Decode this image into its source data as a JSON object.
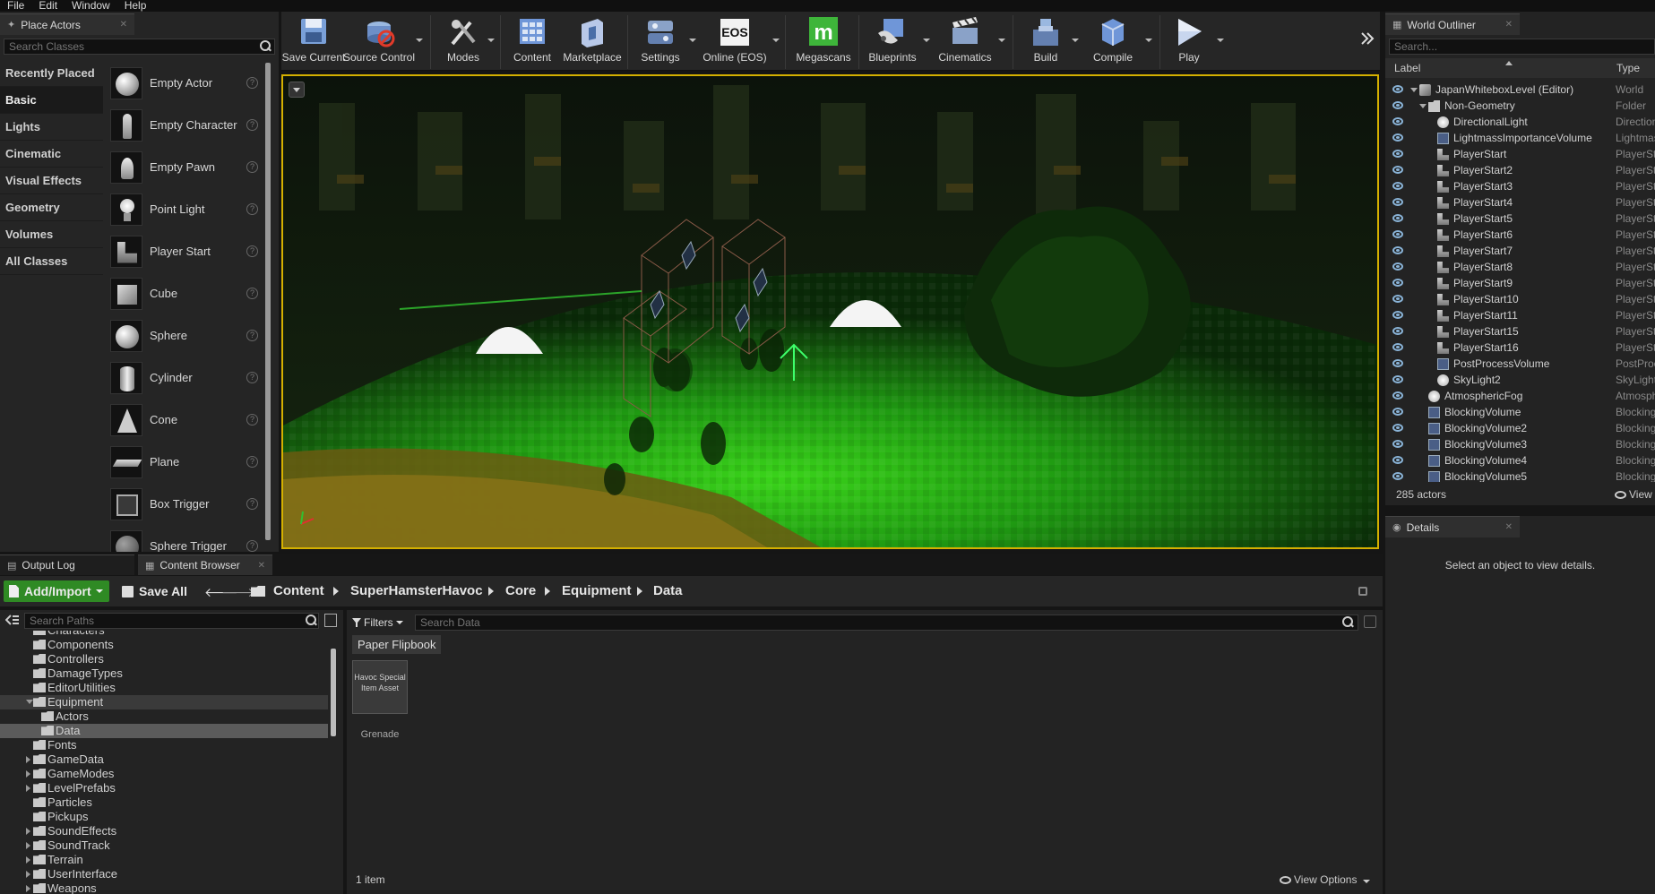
{
  "menu": [
    "File",
    "Edit",
    "Window",
    "Help"
  ],
  "place_actors": {
    "tab_title": "Place Actors",
    "search_placeholder": "Search Classes",
    "categories": [
      "Recently Placed",
      "Basic",
      "Lights",
      "Cinematic",
      "Visual Effects",
      "Geometry",
      "Volumes",
      "All Classes"
    ],
    "active_category": "Basic",
    "items": [
      "Empty Actor",
      "Empty Character",
      "Empty Pawn",
      "Point Light",
      "Player Start",
      "Cube",
      "Sphere",
      "Cylinder",
      "Cone",
      "Plane",
      "Box Trigger",
      "Sphere Trigger"
    ]
  },
  "toolbar": {
    "buttons": [
      {
        "label": "Save Current",
        "icon": "save-icon"
      },
      {
        "label": "Source Control",
        "icon": "source-control-icon"
      },
      {
        "label": "Modes",
        "icon": "modes-icon"
      },
      {
        "label": "Content",
        "icon": "content-icon"
      },
      {
        "label": "Marketplace",
        "icon": "marketplace-icon"
      },
      {
        "label": "Settings",
        "icon": "settings-icon"
      },
      {
        "label": "Online (EOS)",
        "icon": "eos-icon",
        "icon_text": "EOS"
      },
      {
        "label": "Megascans",
        "icon": "megascans-icon",
        "icon_text": "m"
      },
      {
        "label": "Blueprints",
        "icon": "blueprints-icon"
      },
      {
        "label": "Cinematics",
        "icon": "cinematics-icon"
      },
      {
        "label": "Build",
        "icon": "build-icon"
      },
      {
        "label": "Compile",
        "icon": "compile-icon"
      },
      {
        "label": "Play",
        "icon": "play-icon"
      }
    ],
    "accent_green": "#3eb53a",
    "accent_blue": "#6f96d8"
  },
  "world_outliner": {
    "tab_title": "World Outliner",
    "search_placeholder": "Search...",
    "col_label": "Label",
    "col_type": "Type",
    "rows": [
      {
        "label": "JapanWhiteboxLevel (Editor)",
        "type": "World",
        "icon": "world",
        "indent": 0,
        "tw": "open"
      },
      {
        "label": "Non-Geometry",
        "type": "Folder",
        "icon": "folder",
        "indent": 1,
        "tw": "open"
      },
      {
        "label": "DirectionalLight",
        "type": "DirectionalLight",
        "icon": "light",
        "indent": 2
      },
      {
        "label": "LightmassImportanceVolume",
        "type": "LightmassImportanceVolume",
        "icon": "volume",
        "indent": 2
      },
      {
        "label": "PlayerStart",
        "type": "PlayerStart",
        "icon": "player",
        "indent": 2
      },
      {
        "label": "PlayerStart2",
        "type": "PlayerStart",
        "icon": "player",
        "indent": 2
      },
      {
        "label": "PlayerStart3",
        "type": "PlayerStart",
        "icon": "player",
        "indent": 2
      },
      {
        "label": "PlayerStart4",
        "type": "PlayerStart",
        "icon": "player",
        "indent": 2
      },
      {
        "label": "PlayerStart5",
        "type": "PlayerStart",
        "icon": "player",
        "indent": 2
      },
      {
        "label": "PlayerStart6",
        "type": "PlayerStart",
        "icon": "player",
        "indent": 2
      },
      {
        "label": "PlayerStart7",
        "type": "PlayerStart",
        "icon": "player",
        "indent": 2
      },
      {
        "label": "PlayerStart8",
        "type": "PlayerStart",
        "icon": "player",
        "indent": 2
      },
      {
        "label": "PlayerStart9",
        "type": "PlayerStart",
        "icon": "player",
        "indent": 2
      },
      {
        "label": "PlayerStart10",
        "type": "PlayerStart",
        "icon": "player",
        "indent": 2
      },
      {
        "label": "PlayerStart11",
        "type": "PlayerStart",
        "icon": "player",
        "indent": 2
      },
      {
        "label": "PlayerStart15",
        "type": "PlayerStart",
        "icon": "player",
        "indent": 2
      },
      {
        "label": "PlayerStart16",
        "type": "PlayerStart",
        "icon": "player",
        "indent": 2
      },
      {
        "label": "PostProcessVolume",
        "type": "PostProcessVolume",
        "icon": "volume",
        "indent": 2
      },
      {
        "label": "SkyLight2",
        "type": "SkyLight",
        "icon": "light",
        "indent": 2
      },
      {
        "label": "AtmosphericFog",
        "type": "AtmosphericFog",
        "icon": "light",
        "indent": 1
      },
      {
        "label": "BlockingVolume",
        "type": "BlockingVolume",
        "icon": "volume",
        "indent": 1
      },
      {
        "label": "BlockingVolume2",
        "type": "BlockingVolume",
        "icon": "volume",
        "indent": 1
      },
      {
        "label": "BlockingVolume3",
        "type": "BlockingVolume",
        "icon": "volume",
        "indent": 1
      },
      {
        "label": "BlockingVolume4",
        "type": "BlockingVolume",
        "icon": "volume",
        "indent": 1
      },
      {
        "label": "BlockingVolume5",
        "type": "BlockingVolume",
        "icon": "volume",
        "indent": 1
      }
    ],
    "actor_count": "285 actors",
    "view_options": "View Options"
  },
  "details": {
    "tab_title": "Details",
    "empty_message": "Select an object to view details."
  },
  "bottom_tabs": [
    "Output Log",
    "Content Browser"
  ],
  "content_browser": {
    "add_import": "Add/Import",
    "save_all": "Save All",
    "breadcrumbs": [
      "Content",
      "SuperHamsterHavoc",
      "Core",
      "Equipment",
      "Data"
    ],
    "search_paths_placeholder": "Search Paths",
    "filters_label": "Filters",
    "search_data_placeholder": "Search Data",
    "filter_chip": "Paper Flipbook",
    "tree": [
      {
        "label": "Characters",
        "depth": 0
      },
      {
        "label": "Components",
        "depth": 0
      },
      {
        "label": "Controllers",
        "depth": 0
      },
      {
        "label": "DamageTypes",
        "depth": 0
      },
      {
        "label": "EditorUtilities",
        "depth": 0
      },
      {
        "label": "Equipment",
        "depth": 0,
        "arrow": "open",
        "state": "sel-parent"
      },
      {
        "label": "Actors",
        "depth": 1
      },
      {
        "label": "Data",
        "depth": 1,
        "state": "sel"
      },
      {
        "label": "Fonts",
        "depth": 0
      },
      {
        "label": "GameData",
        "depth": 0,
        "arrow": "closed"
      },
      {
        "label": "GameModes",
        "depth": 0,
        "arrow": "closed"
      },
      {
        "label": "LevelPrefabs",
        "depth": 0,
        "arrow": "closed"
      },
      {
        "label": "Particles",
        "depth": 0
      },
      {
        "label": "Pickups",
        "depth": 0
      },
      {
        "label": "SoundEffects",
        "depth": 0,
        "arrow": "closed"
      },
      {
        "label": "SoundTrack",
        "depth": 0,
        "arrow": "closed"
      },
      {
        "label": "Terrain",
        "depth": 0,
        "arrow": "closed"
      },
      {
        "label": "UserInterface",
        "depth": 0,
        "arrow": "closed"
      },
      {
        "label": "Weapons",
        "depth": 0,
        "arrow": "closed"
      }
    ],
    "asset": {
      "thumb_text": "Havoc Special Item Asset",
      "name": "Grenade"
    },
    "item_count": "1 item",
    "view_options": "View Options"
  }
}
